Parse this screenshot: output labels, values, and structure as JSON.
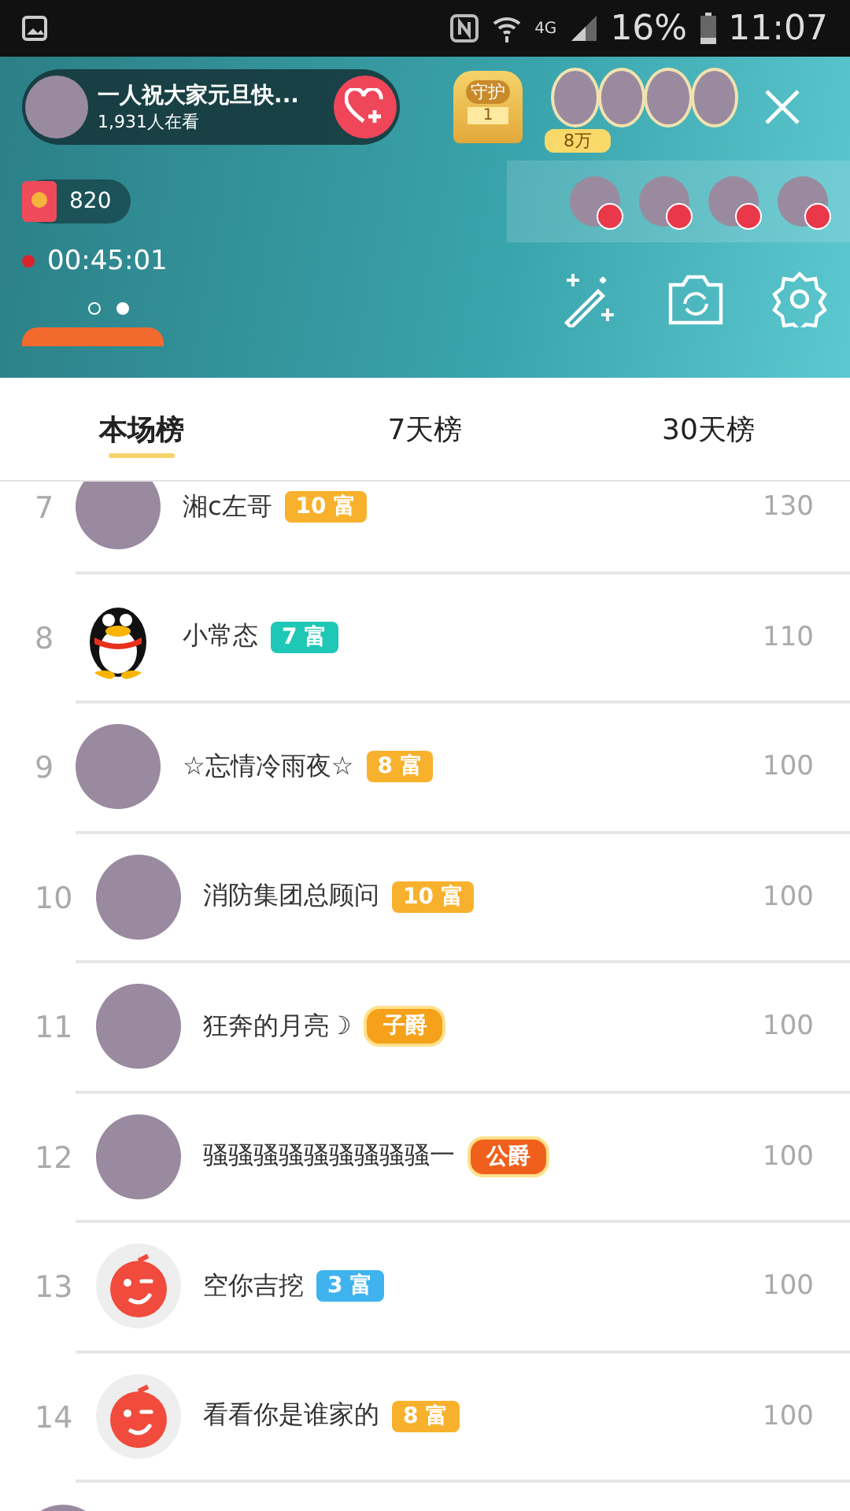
{
  "status_bar": {
    "battery": "16%",
    "time": "11:07",
    "network": "4G"
  },
  "live": {
    "title": "一人祝大家元旦快...",
    "viewers": "1,931人在看",
    "guard": {
      "label": "守护",
      "count": "1"
    },
    "top_fans": {
      "amount": "8万"
    },
    "red_packet": "820",
    "timer": "00:45:01",
    "pages": [
      {
        "selected": false
      },
      {
        "selected": true
      }
    ]
  },
  "tabs": [
    {
      "label": "本场榜",
      "selected": true
    },
    {
      "label": "7天榜",
      "selected": false
    },
    {
      "label": "30天榜",
      "selected": false
    }
  ],
  "rows": [
    {
      "rank": "7",
      "name": "湘c左哥",
      "avatar": {
        "kind": "photo"
      },
      "badge": {
        "kind": "wealth",
        "text": "10 富",
        "color": "#f8b12c"
      },
      "score": "130"
    },
    {
      "rank": "8",
      "name": "小常态",
      "avatar": {
        "kind": "penguin"
      },
      "badge": {
        "kind": "wealth",
        "text": "7 富",
        "color": "#1fc7b6"
      },
      "score": "110"
    },
    {
      "rank": "9",
      "name": "☆忘情冷雨夜☆",
      "avatar": {
        "kind": "photo"
      },
      "badge": {
        "kind": "wealth",
        "text": "8 富",
        "color": "#f8b12c"
      },
      "score": "100"
    },
    {
      "rank": "10",
      "name": "消防集团总顾问",
      "avatar": {
        "kind": "photo"
      },
      "badge": {
        "kind": "wealth",
        "text": "10 富",
        "color": "#f8b12c"
      },
      "score": "100"
    },
    {
      "rank": "11",
      "name": "狂奔的月亮☽",
      "avatar": {
        "kind": "photo"
      },
      "badge": {
        "kind": "noble",
        "text": "子爵",
        "color": "#f5a11a"
      },
      "score": "100"
    },
    {
      "rank": "12",
      "name": "骚骚骚骚骚骚骚骚骚一",
      "avatar": {
        "kind": "photo"
      },
      "badge": {
        "kind": "noble",
        "text": "公爵",
        "color": "#f0601c"
      },
      "score": "100"
    },
    {
      "rank": "13",
      "name": "空你吉挖",
      "avatar": {
        "kind": "mascot"
      },
      "badge": {
        "kind": "wealth",
        "text": "3 富",
        "color": "#3fb3ee"
      },
      "score": "100"
    },
    {
      "rank": "14",
      "name": "看看你是谁家的",
      "avatar": {
        "kind": "mascot"
      },
      "badge": {
        "kind": "wealth",
        "text": "8 富",
        "color": "#f8b12c"
      },
      "score": "100"
    }
  ]
}
